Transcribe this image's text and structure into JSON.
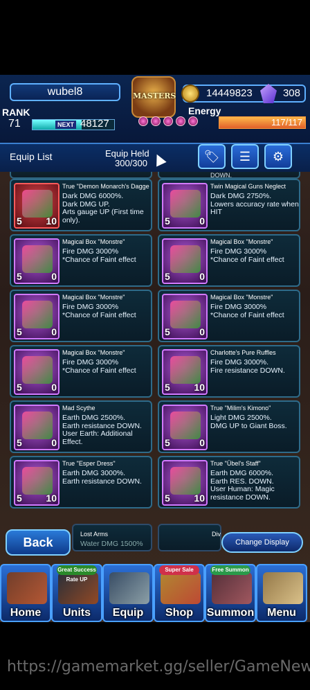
{
  "header": {
    "username": "wubel8",
    "crest_label": "MASTERS",
    "gold": "14449823",
    "crystals": "308",
    "rank_label": "RANK",
    "rank": "71",
    "next_label": "NEXT",
    "exp_to_next": "48127",
    "exp_fraction": 0.6,
    "energy_label": "Energy",
    "energy": "117/117",
    "energy_fraction": 1.0
  },
  "subheader": {
    "title": "Equip List",
    "held_label": "Equip Held",
    "held_value": "300/300"
  },
  "toolbar": {
    "tag_icon": "tag-icon",
    "filter_icon": "filter-icon",
    "settings_icon": "gear-icon"
  },
  "partial_top": {
    "right_desc": "DOWN."
  },
  "items": [
    {
      "name": "True \"Demon Monarch's Dagger\"",
      "desc": "Dark DMG 6000%.\nDark DMG UP.\nArts gauge UP (First time only).",
      "level": "5",
      "count": "10",
      "frame": "red"
    },
    {
      "name": "Twin Magical Guns Neglect",
      "desc": "Dark DMG 2750%.\nLowers accuracy rate when HIT",
      "level": "5",
      "count": "0",
      "frame": "purple"
    },
    {
      "name": "Magical Box \"Monstre\"",
      "desc": "Fire DMG 3000%\n*Chance of Faint effect",
      "level": "5",
      "count": "0",
      "frame": "purple"
    },
    {
      "name": "Magical Box \"Monstre\"",
      "desc": "Fire DMG 3000%\n*Chance of Faint effect",
      "level": "5",
      "count": "0",
      "frame": "purple"
    },
    {
      "name": "Magical Box \"Monstre\"",
      "desc": "Fire DMG 3000%\n*Chance of Faint effect",
      "level": "5",
      "count": "0",
      "frame": "purple"
    },
    {
      "name": "Magical Box \"Monstre\"",
      "desc": "Fire DMG 3000%\n*Chance of Faint effect",
      "level": "5",
      "count": "0",
      "frame": "purple"
    },
    {
      "name": "Magical Box \"Monstre\"",
      "desc": "Fire DMG 3000%\n*Chance of Faint effect",
      "level": "5",
      "count": "0",
      "frame": "purple"
    },
    {
      "name": "Charlotte's Pure Ruffles",
      "desc": "Fire DMG 3000%.\nFire resistance DOWN.",
      "level": "5",
      "count": "10",
      "frame": "purple"
    },
    {
      "name": "Mad Scythe",
      "desc": "Earth DMG 2500%.\nEarth resistance DOWN. User Earth: Additional Effect.",
      "level": "5",
      "count": "0",
      "frame": "purple"
    },
    {
      "name": "True \"Milim's Kimono\"",
      "desc": "Light DMG 2500%.\nDMG UP to Giant Boss.",
      "level": "5",
      "count": "0",
      "frame": "purple"
    },
    {
      "name": "True \"Esper Dress\"",
      "desc": "Earth DMG 3000%.\nEarth resistance DOWN.",
      "level": "5",
      "count": "10",
      "frame": "purple"
    },
    {
      "name": "True \"Übel's Staff\"",
      "desc": "Earth DMG 6000%.\nEarth RES. DOWN.\nUser Human: Magic resistance DOWN.",
      "level": "5",
      "count": "10",
      "frame": "purple"
    }
  ],
  "partial_bottom": {
    "left_name": "Lost Arms",
    "left_desc": "Water DMG 1500%",
    "right_name": "Div"
  },
  "controls": {
    "back": "Back",
    "change_display": "Change Display"
  },
  "nav": [
    {
      "label": "Home",
      "tag": "",
      "icon": "house-icon"
    },
    {
      "label": "Units",
      "tag": "Great Success Rate UP",
      "icon": "hero-icon"
    },
    {
      "label": "Equip",
      "tag": "",
      "icon": "sword-shield-icon"
    },
    {
      "label": "Shop",
      "tag": "Super Sale",
      "icon": "treasure-icon"
    },
    {
      "label": "Summon",
      "tag": "Free Summon",
      "icon": "crossover-icon"
    },
    {
      "label": "Menu",
      "tag": "",
      "icon": "book-icon"
    }
  ],
  "watermark": "https://gamemarket.gg/seller/GameNews"
}
